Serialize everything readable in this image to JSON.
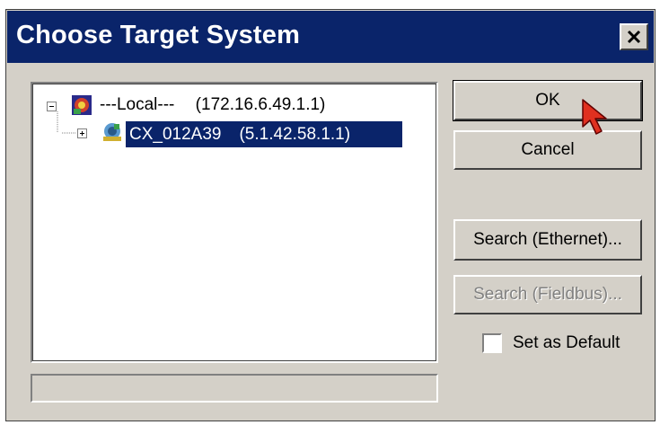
{
  "dialog": {
    "title": "Choose Target System",
    "close_label": "×"
  },
  "tree": {
    "root": {
      "label": "---Local---",
      "address": "(172.16.6.49.1.1)",
      "expander": "collapse",
      "icon": "plc-runtime-icon"
    },
    "child": {
      "label": "CX_012A39",
      "address": "(5.1.42.58.1.1)",
      "expander": "expand",
      "icon": "network-device-icon",
      "selected": true
    }
  },
  "buttons": {
    "ok": "OK",
    "cancel": "Cancel",
    "search_ethernet": "Search (Ethernet)...",
    "search_fieldbus": "Search (Fieldbus)..."
  },
  "default_checkbox": {
    "label": "Set as Default",
    "checked": false
  },
  "status_text": "",
  "colors": {
    "titlebar": "#0a246a",
    "face": "#d4d0c8",
    "selection": "#0a246a",
    "cursor": "#e03020"
  }
}
